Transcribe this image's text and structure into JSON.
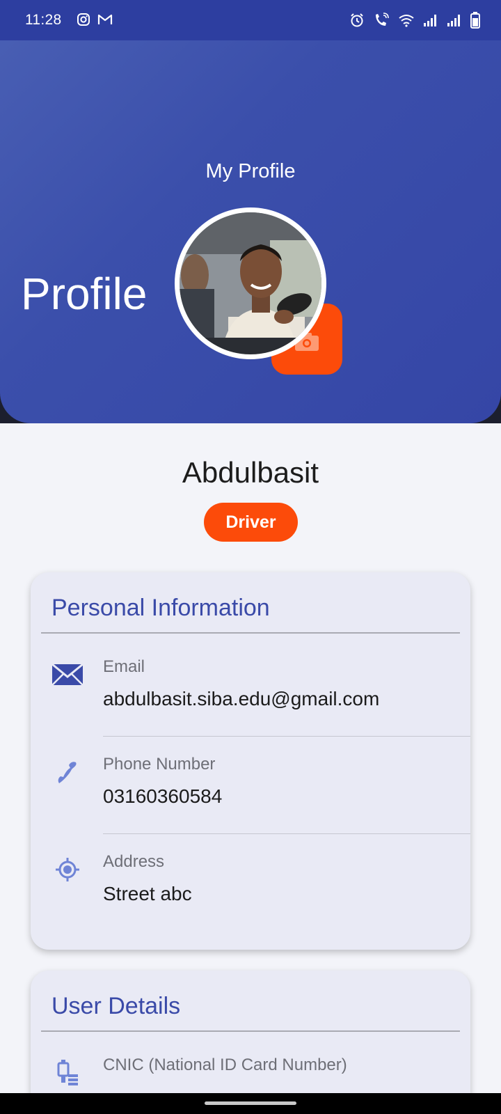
{
  "status_bar": {
    "time": "11:28",
    "left_icons": [
      "instagram-icon",
      "gmail-icon"
    ],
    "right_icons": [
      "alarm-icon",
      "wifi-call-icon",
      "wifi-icon",
      "signal-icon",
      "signal-icon",
      "battery-icon"
    ]
  },
  "header": {
    "title": "My Profile",
    "big_label": "Profile",
    "background_color": "#3b4fab"
  },
  "profile": {
    "name": "Abdulbasit",
    "role": "Driver",
    "accent_color": "#fc4b0a"
  },
  "personal_info": {
    "title": "Personal Information",
    "rows": [
      {
        "icon": "email-icon",
        "label": "Email",
        "value": "abdulbasit.siba.edu@gmail.com"
      },
      {
        "icon": "phone-icon",
        "label": "Phone Number",
        "value": "03160360584"
      },
      {
        "icon": "location-icon",
        "label": "Address",
        "value": "Street abc"
      }
    ]
  },
  "user_details": {
    "title": "User Details",
    "rows": [
      {
        "icon": "id-card-icon",
        "label": "CNIC (National ID Card Number)",
        "value": ""
      }
    ]
  }
}
